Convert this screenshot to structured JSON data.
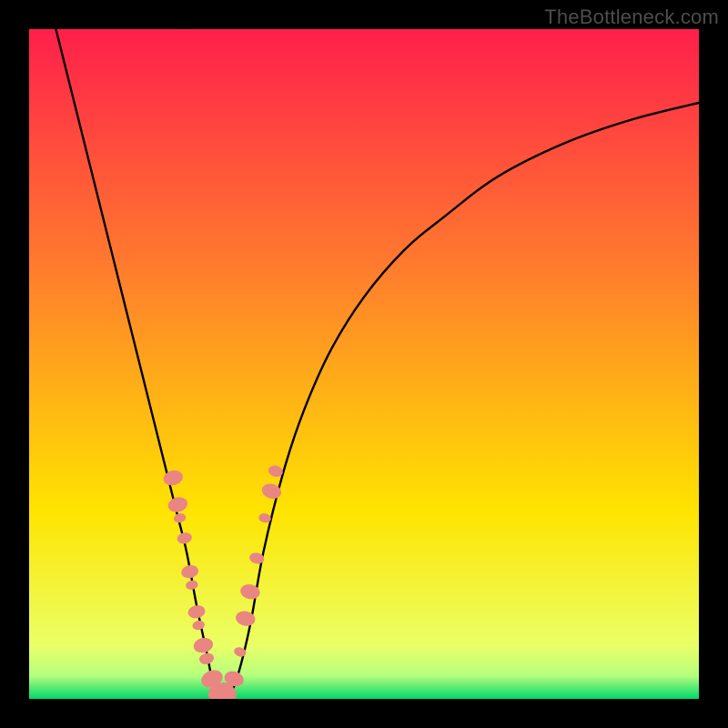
{
  "watermark": "TheBottleneck.com",
  "chart_data": {
    "type": "line",
    "title": "",
    "xlabel": "",
    "ylabel": "",
    "xlim": [
      0,
      100
    ],
    "ylim": [
      0,
      100
    ],
    "background_gradient": {
      "top_color": "#ff1f4b",
      "mid_color": "#ffe400",
      "bottom_color": "#00d86b",
      "stops": [
        0,
        0.72,
        0.97,
        1.0
      ]
    },
    "series": [
      {
        "name": "bottleneck-curve",
        "color": "#000000",
        "x": [
          4,
          6,
          8,
          10,
          12,
          14,
          16,
          18,
          20,
          22,
          23.5,
          25,
          26.5,
          28,
          29.5,
          31,
          33,
          35,
          38,
          41,
          45,
          50,
          56,
          62,
          70,
          80,
          90,
          100
        ],
        "y": [
          100,
          92,
          84,
          76,
          68,
          60,
          52,
          44,
          36,
          28,
          22,
          14,
          7,
          0,
          0,
          3,
          11,
          22,
          34,
          43,
          52,
          60,
          67,
          72,
          78,
          83,
          86.5,
          89
        ]
      }
    ],
    "markers": {
      "name": "sample-points",
      "color": "#e98681",
      "stroke": "#d26e69",
      "radius_range": [
        5,
        11
      ],
      "points": [
        {
          "x": 21.5,
          "y": 33,
          "r": 8
        },
        {
          "x": 22.2,
          "y": 29,
          "r": 8
        },
        {
          "x": 22.5,
          "y": 27,
          "r": 5
        },
        {
          "x": 23.2,
          "y": 24,
          "r": 6
        },
        {
          "x": 24.0,
          "y": 19,
          "r": 7
        },
        {
          "x": 24.3,
          "y": 17,
          "r": 5
        },
        {
          "x": 25.0,
          "y": 13,
          "r": 7
        },
        {
          "x": 25.3,
          "y": 11,
          "r": 5
        },
        {
          "x": 26.0,
          "y": 8,
          "r": 8
        },
        {
          "x": 26.5,
          "y": 6,
          "r": 6
        },
        {
          "x": 27.3,
          "y": 3,
          "r": 9
        },
        {
          "x": 28.3,
          "y": 1,
          "r": 9
        },
        {
          "x": 29.5,
          "y": 1,
          "r": 9
        },
        {
          "x": 30.6,
          "y": 3,
          "r": 8
        },
        {
          "x": 31.5,
          "y": 7,
          "r": 5
        },
        {
          "x": 32.3,
          "y": 12,
          "r": 8
        },
        {
          "x": 33.0,
          "y": 16,
          "r": 8
        },
        {
          "x": 34.0,
          "y": 21,
          "r": 6
        },
        {
          "x": 35.2,
          "y": 27,
          "r": 5
        },
        {
          "x": 36.2,
          "y": 31,
          "r": 8
        },
        {
          "x": 36.8,
          "y": 34,
          "r": 6
        }
      ]
    },
    "bottom_band": {
      "color_top": "#f4ff9e",
      "color_bottom": "#00d36a",
      "y_start": 0,
      "y_end": 6
    }
  }
}
